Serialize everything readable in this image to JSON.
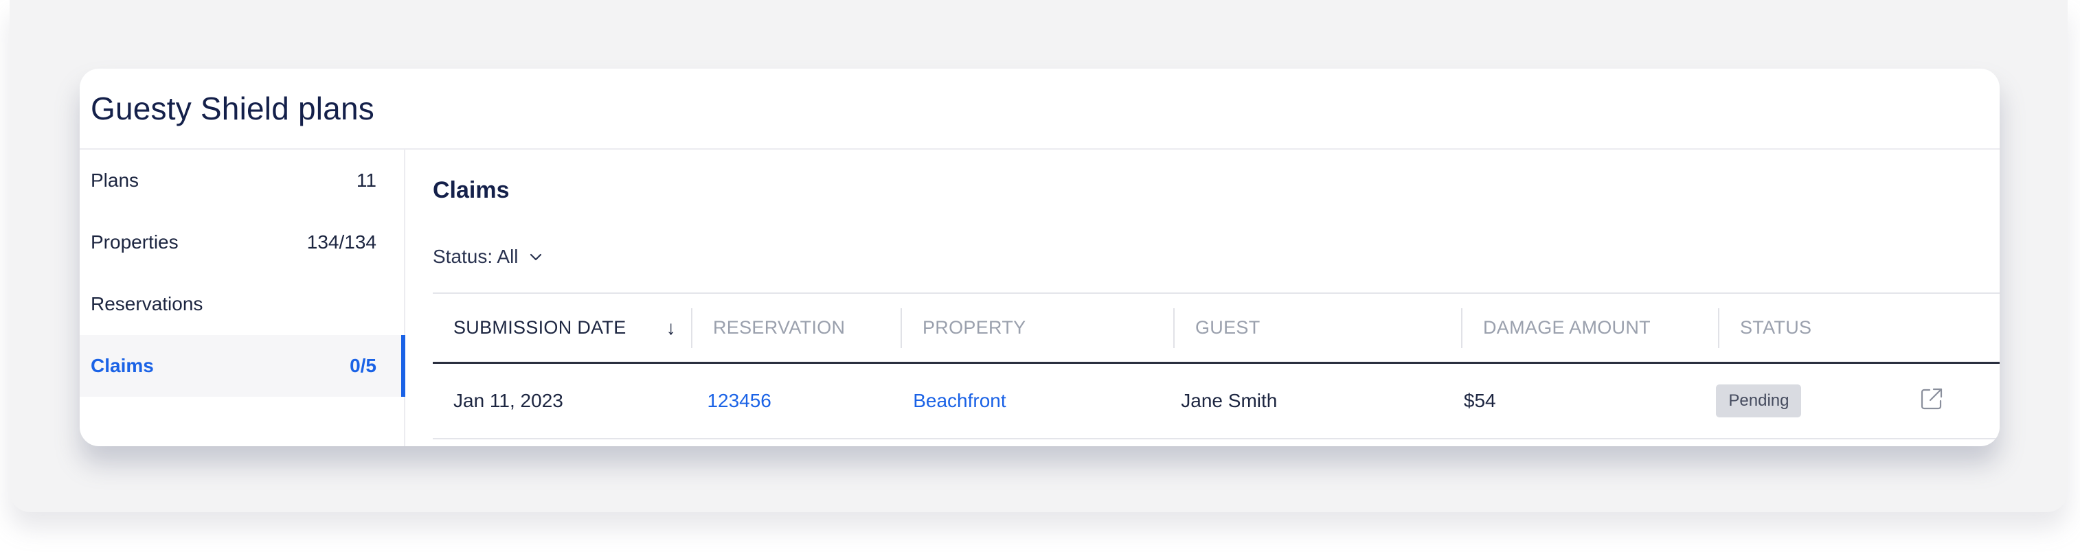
{
  "card": {
    "title": "Guesty Shield plans"
  },
  "sidebar": {
    "items": [
      {
        "label": "Plans",
        "count": "11",
        "active": false
      },
      {
        "label": "Properties",
        "count": "134/134",
        "active": false
      },
      {
        "label": "Reservations",
        "count": "",
        "active": false
      },
      {
        "label": "Claims",
        "count": "0/5",
        "active": true
      }
    ]
  },
  "main": {
    "title": "Claims",
    "filter": {
      "label": "Status: All",
      "icon": "chevron-down-icon"
    }
  },
  "table": {
    "columns": [
      {
        "label": "SUBMISSION DATE",
        "sorted": true,
        "sort_icon": "↓"
      },
      {
        "label": "RESERVATION"
      },
      {
        "label": "PROPERTY"
      },
      {
        "label": "GUEST"
      },
      {
        "label": "DAMAGE AMOUNT"
      },
      {
        "label": "STATUS"
      }
    ],
    "rows": [
      {
        "submission_date": "Jan 11, 2023",
        "reservation": "123456",
        "property": "Beachfront",
        "guest": "Jane Smith",
        "damage_amount": "$54",
        "status": "Pending",
        "action_icon": "external-link-icon"
      }
    ]
  },
  "colors": {
    "accent": "#1a62e6",
    "title": "#14204a",
    "badge_bg": "#d9dbe1",
    "header_muted": "#9aa0ad"
  }
}
